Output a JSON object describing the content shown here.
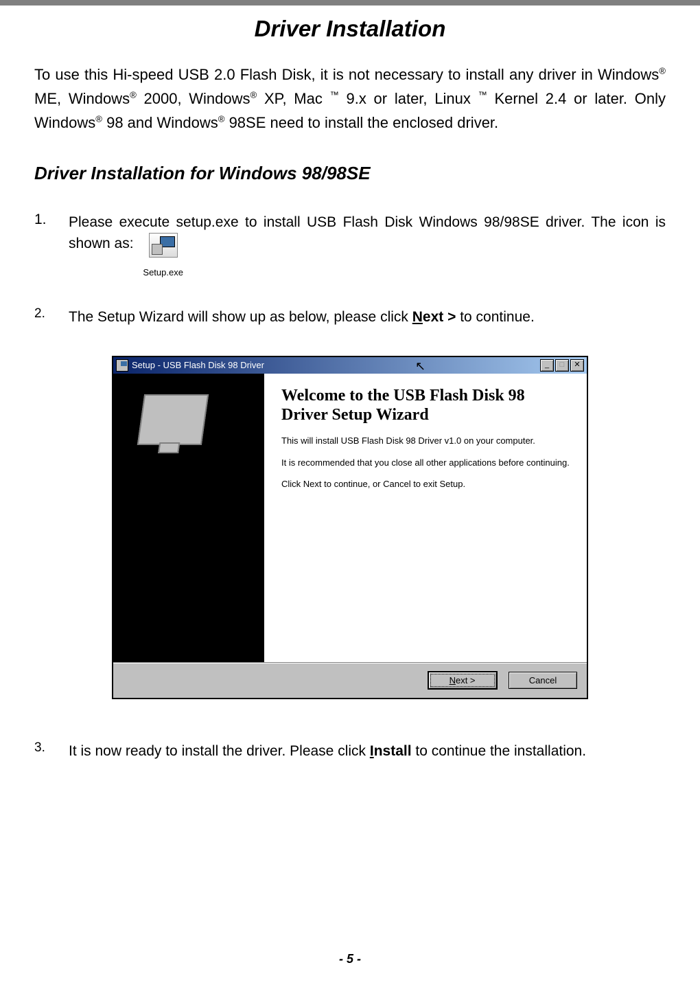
{
  "page": {
    "title": "Driver Installation",
    "intro_html": "To use this Hi-speed USB 2.0 Flash Disk, it is not necessary to install any driver in Windows<sup>®</sup> ME, Windows<sup>®</sup> 2000, Windows<sup>®</sup> XP, Mac <sup>™</sup> 9.x or later, Linux <sup>™</sup> Kernel 2.4 or later. Only Windows<sup>®</sup> 98 and Windows<sup>®</sup> 98SE need to install the enclosed driver.",
    "section_heading": "Driver Installation for Windows 98/98SE",
    "step1_num": "1.",
    "step1_text": "Please execute setup.exe to install USB Flash Disk Windows 98/98SE driver. The icon is shown as:",
    "setup_icon_label": "Setup.exe",
    "step2_num": "2.",
    "step2_before": "The Setup Wizard will show up as below, please click ",
    "step2_hot": "N",
    "step2_mid": "ext >",
    "step2_after": " to continue.",
    "step3_num": "3.",
    "step3_before": "It is now ready to install the driver. Please click ",
    "step3_hot": "I",
    "step3_mid": "nstall",
    "step3_after": " to continue the installation.",
    "footer": "- 5 -"
  },
  "dialog": {
    "title": "Setup - USB Flash Disk 98 Driver",
    "heading": "Welcome to the USB Flash Disk 98 Driver Setup Wizard",
    "p1": "This will install USB Flash Disk 98 Driver v1.0 on your computer.",
    "p2": "It is recommended that you close all other applications before continuing.",
    "p3": "Click Next to continue, or Cancel to exit Setup.",
    "btn_next_hot": "N",
    "btn_next_rest": "ext >",
    "btn_cancel": "Cancel",
    "min_glyph": "_",
    "max_glyph": "□",
    "close_glyph": "✕"
  }
}
